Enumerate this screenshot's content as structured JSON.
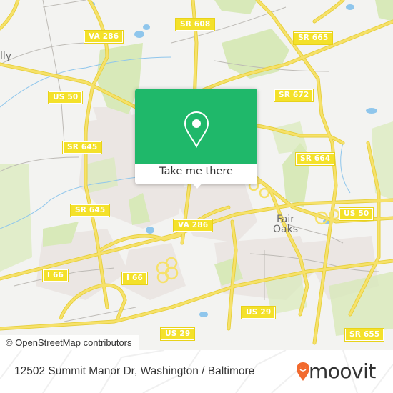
{
  "map": {
    "shields": [
      {
        "id": "va286-top",
        "label": "VA 286"
      },
      {
        "id": "sr608",
        "label": "SR 608"
      },
      {
        "id": "sr665",
        "label": "SR 665"
      },
      {
        "id": "us50-west",
        "label": "US 50"
      },
      {
        "id": "sr672",
        "label": "SR 672"
      },
      {
        "id": "sr645-north",
        "label": "SR 645"
      },
      {
        "id": "sr664",
        "label": "SR 664"
      },
      {
        "id": "sr645-south",
        "label": "SR 645"
      },
      {
        "id": "va286-mid",
        "label": "VA 286"
      },
      {
        "id": "us50-east",
        "label": "US 50"
      },
      {
        "id": "i66-west",
        "label": "I 66"
      },
      {
        "id": "i66-mid",
        "label": "I 66"
      },
      {
        "id": "us29-mid",
        "label": "US 29"
      },
      {
        "id": "us29-west",
        "label": "US 29"
      },
      {
        "id": "sr655",
        "label": "SR 655"
      }
    ],
    "places": [
      {
        "id": "fair-oaks",
        "line1": "Fair",
        "line2": "Oaks"
      },
      {
        "id": "chantilly-partial",
        "line1": "lly"
      }
    ],
    "colors": {
      "road": "#f6e16a",
      "road_outline": "#e6cf3a",
      "park": "#d8e9b9",
      "water": "#8fc6ec",
      "urban": "#ebe6e3",
      "land": "#f3f3f1"
    }
  },
  "popup": {
    "icon": "location-pin-icon",
    "action_label": "Take me there",
    "accent_color": "#1fb86a"
  },
  "attribution": "© OpenStreetMap contributors",
  "footer": {
    "address": "12502 Summit Manor Dr, Washington / Baltimore",
    "brand": "moovit",
    "brand_color": "#f26a2e"
  }
}
